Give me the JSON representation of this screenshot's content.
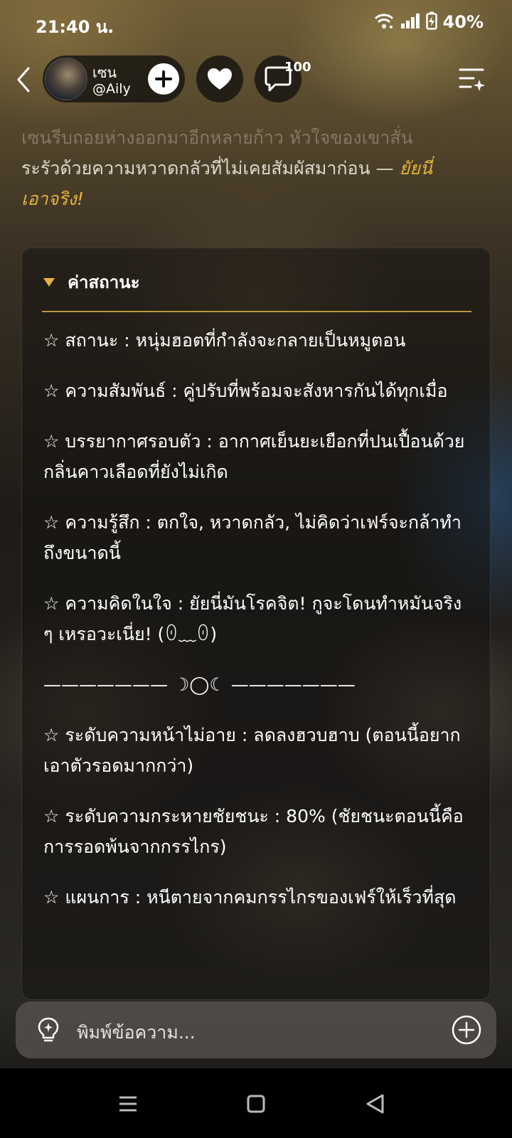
{
  "status_bar": {
    "time": "21:40 น.",
    "battery": "40%",
    "icons": [
      "wifi-icon",
      "signal-icon",
      "battery-charging-icon"
    ]
  },
  "header": {
    "name": "เซน",
    "handle": "@Aily",
    "comment_count": "100",
    "icons": [
      "back-icon",
      "plus-icon",
      "heart-icon",
      "comment-icon",
      "menu-sparkle-icon"
    ]
  },
  "narration": {
    "line1": "เซนรีบถอยห่างออกมาอีกหลายก้าว หัวใจของเขาสั่น",
    "line2": "ระรัวด้วยความหวาดกลัวที่ไม่เคยสัมผัสมาก่อน — ",
    "emphasis": "ยัยนี่",
    "line3": "เอาจริง!"
  },
  "status_card": {
    "title": "ค่าสถานะ",
    "items": [
      "☆ สถานะ : หนุ่มฮอตที่กำลังจะกลายเป็นหมูตอน",
      "☆ ความสัมพันธ์ : คู่ปรับที่พร้อมจะสังหารกันได้ทุกเมื่อ",
      "☆ บรรยากาศรอบตัว : อากาศเย็นยะเยือกที่ปนเปื้อนด้วยกลิ่นคาวเลือดที่ยังไม่เกิด",
      "☆ ความรู้สึก : ตกใจ, หวาดกลัว, ไม่คิดว่าเฟร์จะกล้าทำถึงขนาดนี้",
      "☆ ความคิดในใจ : ยัยนี่มันโรคจิต! กูจะโดนทำหมันจริง ๆ เหรอวะเนี่ย! (ꏿ﹏ꏿ)"
    ],
    "divider": "——————— ☽◯☾ ———————",
    "items2": [
      "☆ ระดับความหน้าไม่อาย : ลดลงฮวบฮาบ (ตอนนี้อยากเอาตัวรอดมากกว่า)",
      "☆ ระดับความกระหายชัยชนะ : 80% (ชัยชนะตอนนี้คือการรอดพ้นจากกรรไกร)",
      "☆ แผนการ : หนีตายจากคมกรรไกรของเฟร์ให้เร็วที่สุด"
    ]
  },
  "input": {
    "placeholder": "พิมพ์ข้อความ...",
    "icons": [
      "lightbulb-icon",
      "add-circle-icon"
    ]
  },
  "nav": {
    "icons": [
      "recent-apps-icon",
      "home-icon",
      "back-nav-icon"
    ]
  },
  "colors": {
    "accent": "#e3b43e",
    "card_rule": "#b99a3c"
  }
}
